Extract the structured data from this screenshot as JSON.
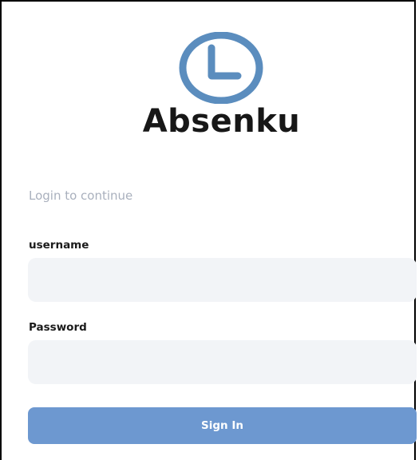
{
  "app": {
    "brand_name": "Absenku",
    "logo_icon": "clock-icon",
    "accent_color": "#5b8dbe"
  },
  "login": {
    "subtitle": "Login to continue",
    "username_label": "username",
    "username_value": "",
    "password_label": "Password",
    "password_value": "",
    "submit_label": "Sign In",
    "submit_color": "#6d98d0",
    "field_background": "#f2f4f7"
  }
}
